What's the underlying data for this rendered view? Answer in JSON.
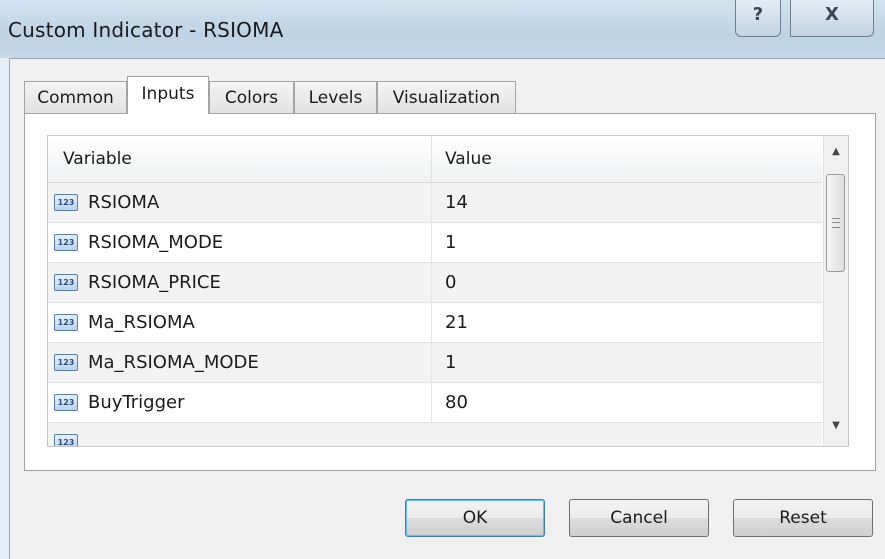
{
  "window": {
    "title": "Custom Indicator - RSIOMA",
    "help_label": "?",
    "close_label": "X"
  },
  "tabs": [
    {
      "label": "Common",
      "active": false
    },
    {
      "label": "Inputs",
      "active": true
    },
    {
      "label": "Colors",
      "active": false
    },
    {
      "label": "Levels",
      "active": false
    },
    {
      "label": "Visualization",
      "active": false
    }
  ],
  "inputs": {
    "columns": [
      "Variable",
      "Value"
    ],
    "icon": "integer-type-icon",
    "icon_text": "123",
    "rows": [
      {
        "variable": "RSIOMA",
        "value": "14"
      },
      {
        "variable": "RSIOMA_MODE",
        "value": "1"
      },
      {
        "variable": "RSIOMA_PRICE",
        "value": "0"
      },
      {
        "variable": "Ma_RSIOMA",
        "value": "21"
      },
      {
        "variable": "Ma_RSIOMA_MODE",
        "value": "1"
      },
      {
        "variable": "BuyTrigger",
        "value": "80"
      }
    ]
  },
  "buttons": {
    "ok": "OK",
    "cancel": "Cancel",
    "reset": "Reset"
  },
  "colors": {
    "title_bar": "#c6d8e8",
    "row_alt": "#f3f3f3",
    "ok_border": "#3c7fb1"
  }
}
